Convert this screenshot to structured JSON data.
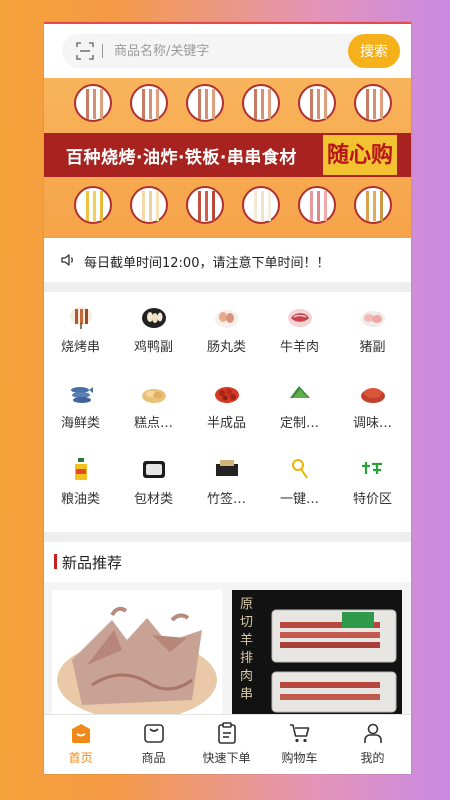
{
  "search": {
    "placeholder": "商品名称/关键字",
    "button_label": "搜索"
  },
  "banner": {
    "title": "百种烧烤·油炸·铁板·串串食材",
    "logo_text": "随心购"
  },
  "notice": {
    "text": "每日截单时间12:00，请注意下单时间！！"
  },
  "categories": [
    {
      "label": "烧烤串",
      "icon": "skewer-icon"
    },
    {
      "label": "鸡鸭副",
      "icon": "chicken-icon"
    },
    {
      "label": "肠丸类",
      "icon": "sausage-icon"
    },
    {
      "label": "牛羊肉",
      "icon": "meat-icon"
    },
    {
      "label": "猪副",
      "icon": "pork-icon"
    },
    {
      "label": "海鲜类",
      "icon": "fish-icon"
    },
    {
      "label": "糕点…",
      "icon": "pastry-icon"
    },
    {
      "label": "半成品",
      "icon": "crawfish-icon"
    },
    {
      "label": "定制…",
      "icon": "custom-icon"
    },
    {
      "label": "调味…",
      "icon": "seasoning-icon"
    },
    {
      "label": "粮油类",
      "icon": "oil-bottle-icon"
    },
    {
      "label": "包材类",
      "icon": "container-icon"
    },
    {
      "label": "竹签…",
      "icon": "bamboo-icon"
    },
    {
      "label": "一键…",
      "icon": "one-click-icon"
    },
    {
      "label": "特价区",
      "icon": "special-offer-icon"
    }
  ],
  "section": {
    "title": "新品推荐"
  },
  "products": [
    {
      "name": "squid-product",
      "image": "dried-squid"
    },
    {
      "name": "lamb-skewer-product",
      "image": "lamb-skewers",
      "image_text": "原切羊排肉串"
    }
  ],
  "tabbar": {
    "active": "home",
    "items": [
      {
        "label": "首页",
        "icon": "home-icon"
      },
      {
        "label": "商品",
        "icon": "shopping-bag-icon"
      },
      {
        "label": "快速下单",
        "icon": "clipboard-icon"
      },
      {
        "label": "购物车",
        "icon": "cart-icon"
      },
      {
        "label": "我的",
        "icon": "user-icon"
      }
    ]
  },
  "colors": {
    "accent": "#f6b01a",
    "active_tab": "#f0891a",
    "brand_red": "#c5201f"
  }
}
